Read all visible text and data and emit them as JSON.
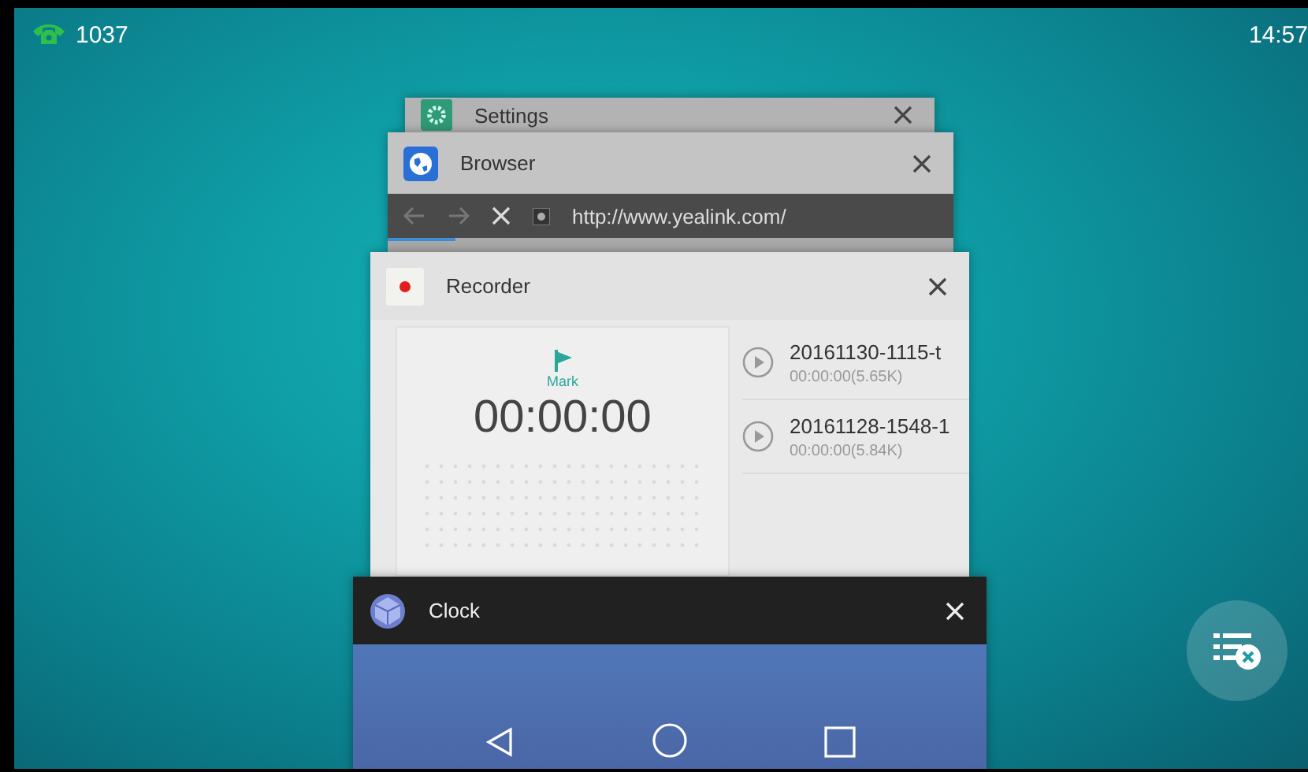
{
  "status_bar": {
    "line": "1037",
    "time": "14:57"
  },
  "recent_apps": [
    {
      "kind": "settings",
      "title": "Settings"
    },
    {
      "kind": "browser",
      "title": "Browser",
      "url": "http://www.yealink.com/",
      "level": 0.12
    },
    {
      "kind": "recorder",
      "title": "Recorder",
      "mark_label": "Mark",
      "timer": "00:00:00",
      "recordings": [
        {
          "name": "20161130-1115-t",
          "info": "00:00:00(5.65K)"
        },
        {
          "name": "20161128-1548-1",
          "info": "00:00:00(5.84K)"
        }
      ]
    },
    {
      "kind": "clock",
      "title": "Clock"
    }
  ]
}
